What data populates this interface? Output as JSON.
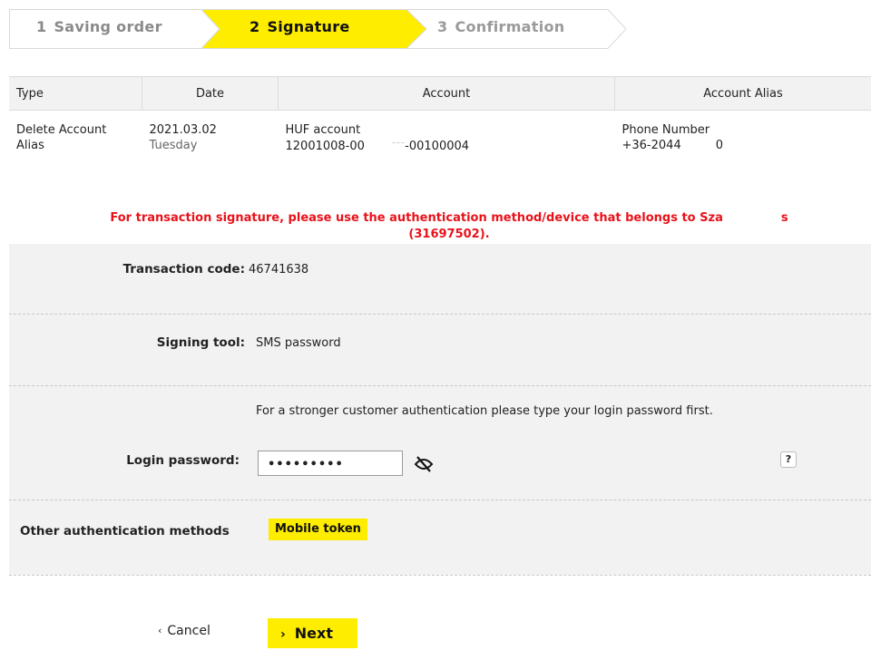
{
  "stepper": {
    "steps": [
      {
        "number": "1",
        "label": "Saving order",
        "state": "done"
      },
      {
        "number": "2",
        "label": "Signature",
        "state": "active"
      },
      {
        "number": "3",
        "label": "Confirmation",
        "state": "pending"
      }
    ],
    "active_color": "#ffed00"
  },
  "table": {
    "headers": {
      "type": "Type",
      "date": "Date",
      "account": "Account",
      "alias": "Account Alias"
    },
    "rows": [
      {
        "type_line1": "Delete Account",
        "type_line2": "Alias",
        "date": "2021.03.02",
        "weekday": "Tuesday",
        "account_name": "HUF account",
        "account_number": "12001008-00",
        "account_number_suffix": "-00100004",
        "alias_type": "Phone Number",
        "alias_value": "+36-2044",
        "alias_value_tail": "0"
      }
    ]
  },
  "warning": {
    "line1": "For transaction signature, please use the authentication method/device that belongs to Sza",
    "line1_tail": "s",
    "line2": "(31697502)."
  },
  "form": {
    "transaction_code_label": "Transaction code:",
    "transaction_code_value": "46741638",
    "signing_tool_label": "Signing tool:",
    "signing_tool_value": "SMS password",
    "strong_auth_note": "For a stronger customer authentication please type your login password first.",
    "login_password_label": "Login password:",
    "login_password_value": "•••••••••",
    "help_label": "?",
    "other_methods_label": "Other authentication methods",
    "mobile_token_label": "Mobile token"
  },
  "actions": {
    "cancel_label": "Cancel",
    "next_label": "Next"
  },
  "colors": {
    "accent": "#ffed00",
    "warning": "#e8121a",
    "panel": "#f2f2f2"
  }
}
